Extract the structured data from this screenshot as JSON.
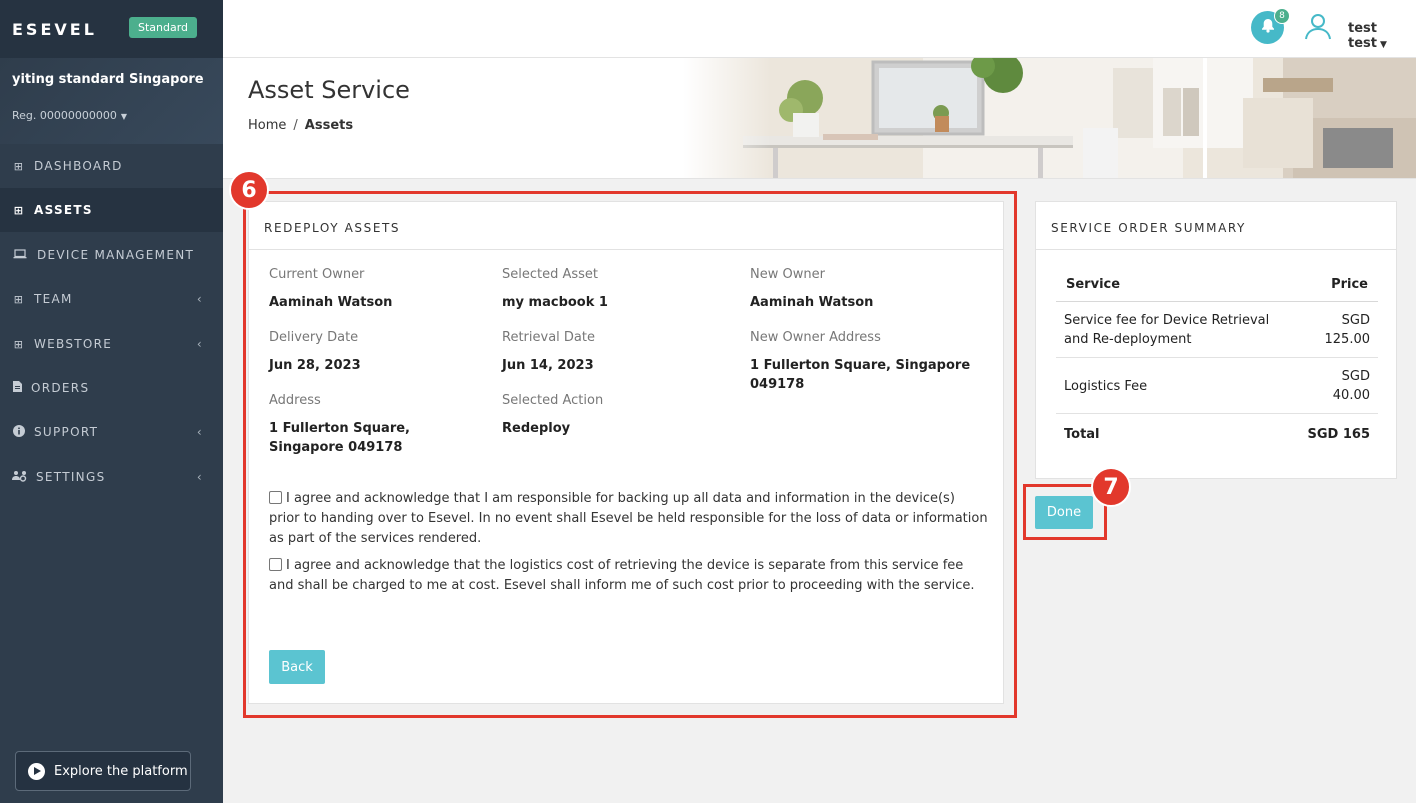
{
  "sidebar": {
    "brand": "ESEVEL",
    "plan": "Standard",
    "org_name": "yiting standard Singapore",
    "org_reg": "Reg. 00000000000",
    "items": [
      {
        "label": "DASHBOARD",
        "icon": "grid-icon"
      },
      {
        "label": "ASSETS",
        "icon": "grid-icon"
      },
      {
        "label": "DEVICE MANAGEMENT",
        "icon": "laptop-icon"
      },
      {
        "label": "TEAM",
        "icon": "grid-icon"
      },
      {
        "label": "WEBSTORE",
        "icon": "grid-icon"
      },
      {
        "label": "ORDERS",
        "icon": "document-icon"
      },
      {
        "label": "SUPPORT",
        "icon": "info-icon"
      },
      {
        "label": "SETTINGS",
        "icon": "users-gear-icon"
      }
    ],
    "active_item": "ASSETS",
    "explore_label": "Explore the platform"
  },
  "topbar": {
    "notification_count": "8",
    "user_name": "test test"
  },
  "header": {
    "title": "Asset Service",
    "breadcrumb": [
      "Home",
      "Assets"
    ]
  },
  "redeploy": {
    "title": "REDEPLOY ASSETS",
    "fields": {
      "current_owner": {
        "label": "Current Owner",
        "value": "Aaminah Watson"
      },
      "selected_asset": {
        "label": "Selected Asset",
        "value": "my macbook 1"
      },
      "new_owner": {
        "label": "New Owner",
        "value": "Aaminah Watson"
      },
      "delivery_date": {
        "label": "Delivery Date",
        "value": "Jun 28, 2023"
      },
      "retrieval_date": {
        "label": "Retrieval Date",
        "value": "Jun 14, 2023"
      },
      "new_owner_address": {
        "label": "New Owner Address",
        "value": "1 Fullerton Square, Singapore 049178"
      },
      "address": {
        "label": "Address",
        "value": "1 Fullerton Square, Singapore 049178"
      },
      "selected_action": {
        "label": "Selected Action",
        "value": "Redeploy"
      }
    },
    "agreements": [
      {
        "text": "I agree and acknowledge that I am responsible for backing up all data and information in the device(s) prior to handing over to Esevel. In no event shall Esevel be held responsible for the loss of data or information as part of the services rendered.",
        "checked": false
      },
      {
        "text": "I agree and acknowledge that the logistics cost of retrieving the device is separate from this service fee and shall be charged to me at cost. Esevel shall inform me of such cost prior to proceeding with the service.",
        "checked": false
      }
    ],
    "back_label": "Back"
  },
  "summary": {
    "title": "SERVICE ORDER SUMMARY",
    "headers": {
      "service": "Service",
      "price": "Price"
    },
    "rows": [
      {
        "service": "Service fee for Device Retrieval and Re-deployment",
        "price_currency": "SGD",
        "price_amount": "125.00"
      },
      {
        "service": "Logistics Fee",
        "price_currency": "SGD",
        "price_amount": "40.00"
      }
    ],
    "total_label": "Total",
    "total_value": "SGD 165",
    "done_label": "Done"
  },
  "annotations": {
    "step_6": "6",
    "step_7": "7",
    "color": "#e2382c"
  },
  "colors": {
    "sidebar_bg": "#2f3d4c",
    "accent": "#5bc4d1",
    "badge_green": "#4caf8d"
  }
}
